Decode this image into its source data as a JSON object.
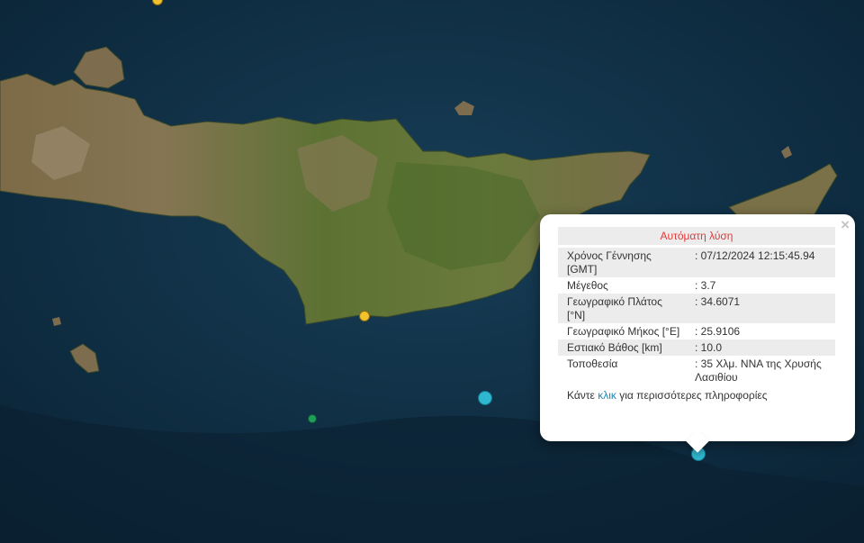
{
  "popup": {
    "header": "Αυτόματη λύση",
    "close_glyph": "×",
    "rows": [
      {
        "label": "Χρόνος Γέννησης [GMT]",
        "value": ": 07/12/2024 12:15:45.94"
      },
      {
        "label": "Μέγεθος",
        "value": ": 3.7"
      },
      {
        "label": "Γεωγραφικό Πλάτος [°N]",
        "value": ": 34.6071"
      },
      {
        "label": "Γεωγραφικό Μήκος [°E]",
        "value": ": 25.9106"
      },
      {
        "label": "Εστιακό Βάθος [km]",
        "value": ": 10.0"
      },
      {
        "label": "Τοποθεσία",
        "value": ": 35 Χλμ. ΝΝΑ της Χρυσής Λασιθίου"
      }
    ],
    "footer": {
      "prefix": "Κάντε ",
      "link": "κλικ",
      "suffix": " για περισσότερες πληροφορίες"
    }
  },
  "colors": {
    "sea": "#0d2a3e",
    "land_green": "#4f6a2e",
    "land_brown": "#8a7250",
    "marker_yellow": "#f2c12e",
    "marker_cyan": "#2fb7cf",
    "marker_green": "#1f9e5a",
    "header_red": "#e03b3b",
    "link_blue": "#1f87b8"
  }
}
